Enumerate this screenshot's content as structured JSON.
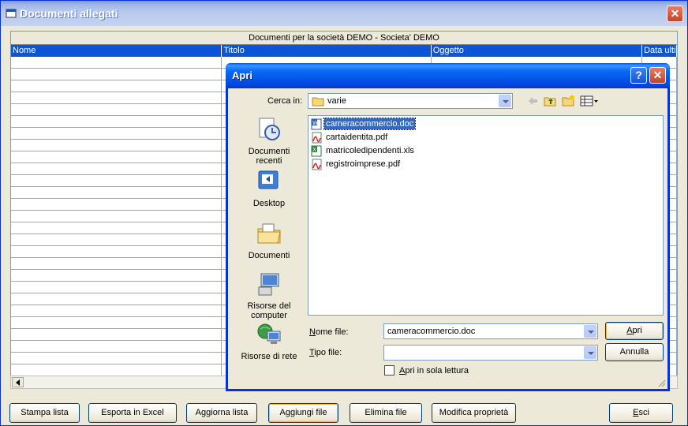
{
  "window": {
    "title": "Documenti allegati",
    "close_label": "✕"
  },
  "grid": {
    "caption": "Documenti per la società DEMO - Societa' DEMO",
    "columns": [
      {
        "label": "Nome"
      },
      {
        "label": "Titolo"
      },
      {
        "label": "Oggetto"
      },
      {
        "label": "Data ultim"
      }
    ]
  },
  "buttons": {
    "stampa": "Stampa lista",
    "esporta": "Esporta in Excel",
    "aggiorna": "Aggiorna lista",
    "aggiungi": "Aggiungi file",
    "elimina": "Elimina file",
    "modifica": "Modifica proprietà",
    "esci": "Esci"
  },
  "dialog": {
    "title": "Apri",
    "help_label": "?",
    "close_label": "✕",
    "look_in_label": "Cerca in:",
    "look_in_value": "varie",
    "places": [
      {
        "label": "Documenti recenti"
      },
      {
        "label": "Desktop"
      },
      {
        "label": "Documenti"
      },
      {
        "label": "Risorse del computer"
      },
      {
        "label": "Risorse di rete"
      }
    ],
    "files": [
      {
        "name": "cameracommercio.doc",
        "type": "doc"
      },
      {
        "name": "cartaidentita.pdf",
        "type": "pdf"
      },
      {
        "name": "matricoledipendenti.xls",
        "type": "xls"
      },
      {
        "name": "registroimprese.pdf",
        "type": "pdf"
      }
    ],
    "filename_label": "Nome file:",
    "filename_value": "cameracommercio.doc",
    "filetype_label": "Tipo file:",
    "filetype_value": "",
    "readonly_label": "Apri in sola lettura",
    "open_button": "Apri",
    "cancel_button": "Annulla"
  }
}
